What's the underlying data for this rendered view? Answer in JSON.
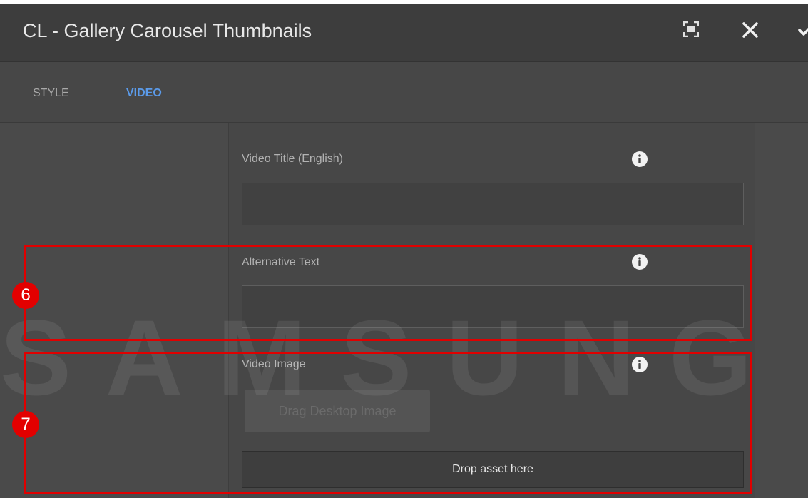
{
  "dialog": {
    "title": "CL - Gallery Carousel Thumbnails",
    "icons": [
      "fullscreen-icon",
      "close-icon",
      "check-icon"
    ]
  },
  "tabs": [
    {
      "label": "STYLE",
      "active": false
    },
    {
      "label": "VIDEO",
      "active": true
    }
  ],
  "fields": {
    "video_title": {
      "label": "Video Title (English)",
      "value": ""
    },
    "alt_text": {
      "label": "Alternative Text",
      "value": ""
    },
    "video_image": {
      "label": "Video Image",
      "drag_button_label": "Drag Desktop Image",
      "drop_zone_label": "Drop asset here"
    }
  },
  "watermark": "SAMSUNG",
  "callouts": [
    {
      "number": "6"
    },
    {
      "number": "7"
    }
  ],
  "colors": {
    "accent": "#5b9bea",
    "callout": "#e30000",
    "panel": "#474747",
    "titlebar": "#3d3d3d"
  }
}
